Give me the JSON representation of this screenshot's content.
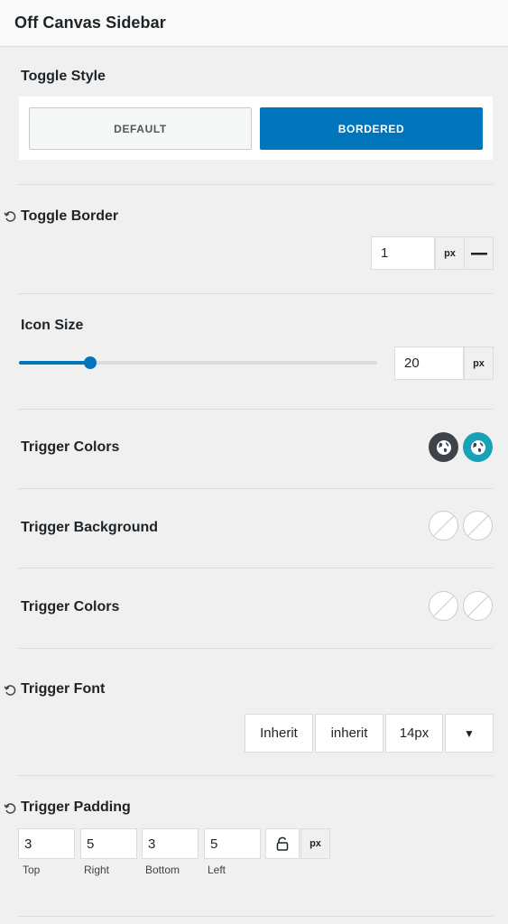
{
  "header": {
    "title": "Off Canvas Sidebar"
  },
  "toggle_style": {
    "label": "Toggle Style",
    "options": [
      "DEFAULT",
      "BORDERED"
    ],
    "selected": "BORDERED"
  },
  "toggle_border": {
    "label": "Toggle Border",
    "value": "1",
    "unit": "px"
  },
  "icon_size": {
    "label": "Icon Size",
    "value": "20",
    "unit": "px",
    "slider_fraction": 0.2
  },
  "trigger_colors_1": {
    "label": "Trigger Colors",
    "swatches": [
      "#3c434a",
      "#17a2b8"
    ]
  },
  "trigger_background": {
    "label": "Trigger Background"
  },
  "trigger_colors_2": {
    "label": "Trigger Colors"
  },
  "trigger_font": {
    "label": "Trigger Font",
    "family": "Inherit",
    "weight": "inherit",
    "size": "14px",
    "dropdown": "▼"
  },
  "trigger_padding": {
    "label": "Trigger Padding",
    "top": "3",
    "right": "5",
    "bottom": "3",
    "left": "5",
    "labels": {
      "top": "Top",
      "right": "Right",
      "bottom": "Bottom",
      "left": "Left"
    },
    "unit": "px"
  },
  "colors": {
    "accent": "#0075bc",
    "teal": "#17a2b8",
    "dark": "#3c434a"
  },
  "icons": [
    "reset-icon",
    "globe-icon",
    "lock-open-icon",
    "minus-icon",
    "caret-down-icon"
  ]
}
